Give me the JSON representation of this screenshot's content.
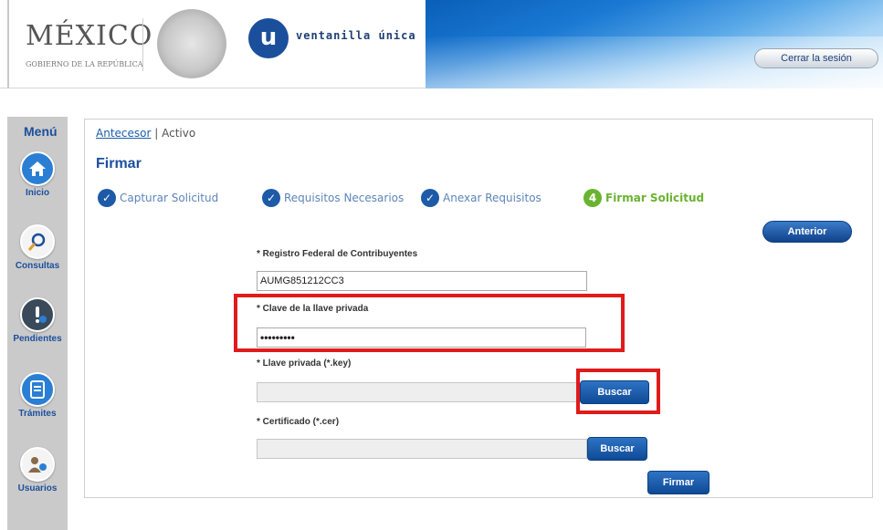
{
  "header": {
    "mexico_title": "MÉXICO",
    "mexico_subtitle": "GOBIERNO DE LA REPÚBLICA",
    "u_letter": "u",
    "app_name": "ventanilla única",
    "logout_label": "Cerrar la sesión"
  },
  "sidebar": {
    "title": "Menú",
    "items": [
      {
        "label": "Inicio",
        "icon": "home-icon",
        "color": "#2a7fd4"
      },
      {
        "label": "Consultas",
        "icon": "search-icon",
        "color": "#ffffff"
      },
      {
        "label": "Pendientes",
        "icon": "pending-icon",
        "color": "#3a4a5a"
      },
      {
        "label": "Trámites",
        "icon": "document-icon",
        "color": "#2a7fd4"
      },
      {
        "label": "Usuarios",
        "icon": "users-icon",
        "color": "#ffffff"
      }
    ]
  },
  "breadcrumb": {
    "link": "Antecesor",
    "separator": "|",
    "current": "Activo"
  },
  "page_title": "Firmar",
  "steps": [
    {
      "label": "Capturar Solicitud",
      "marker": "✓",
      "status": "done"
    },
    {
      "label": "Requisitos Necesarios",
      "marker": "✓",
      "status": "done"
    },
    {
      "label": "Anexar Requisitos",
      "marker": "✓",
      "status": "done"
    },
    {
      "label": "Firmar Solicitud",
      "marker": "4",
      "status": "active"
    }
  ],
  "buttons": {
    "anterior": "Anterior",
    "buscar_key": "Buscar",
    "buscar_cer": "Buscar",
    "firmar": "Firmar"
  },
  "form": {
    "rfc_label": "* Registro Federal de Contribuyentes",
    "rfc_value": "AUMG851212CC3",
    "clave_label": "* Clave de la llave privada",
    "clave_value": "•••••••••",
    "llave_label": "* Llave privada (*.key)",
    "llave_value": "",
    "cert_label": "* Certificado (*.cer)",
    "cert_value": ""
  },
  "colors": {
    "primary_blue": "#1b4f9c",
    "active_green": "#6ab330",
    "highlight_red": "#e01b1b"
  }
}
